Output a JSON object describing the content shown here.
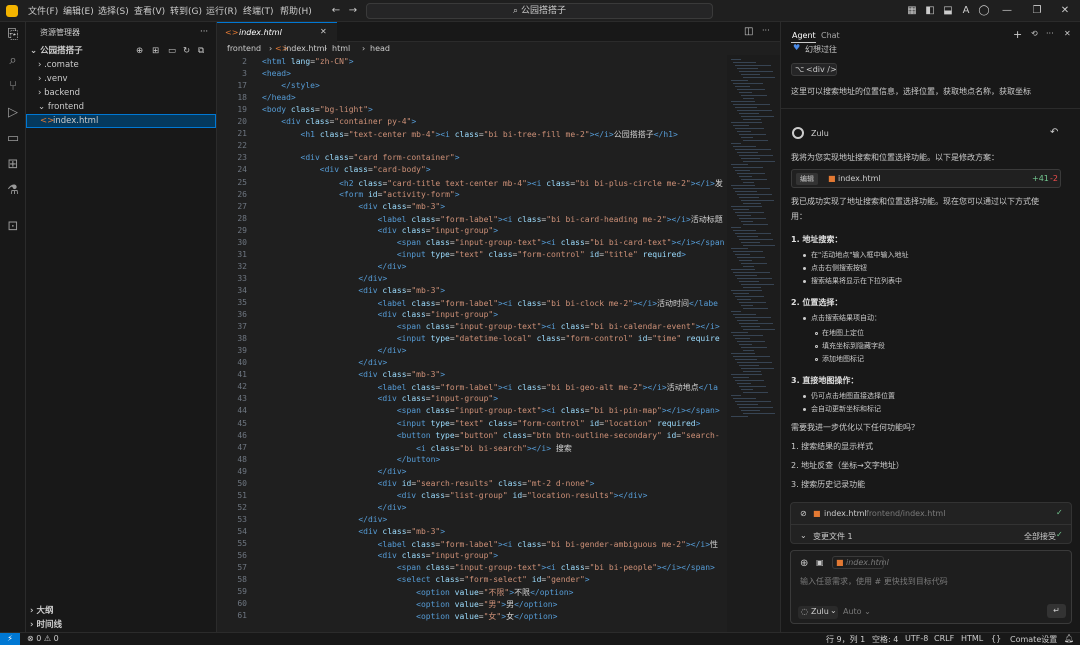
{
  "title_bar": {
    "menus": [
      "文件(F)",
      "编辑(E)",
      "选择(S)",
      "查看(V)",
      "转到(G)",
      "运行(R)",
      "终端(T)",
      "帮助(H)"
    ],
    "search": "公园搭搭子",
    "nav_back": "←",
    "nav_forward": "→"
  },
  "explorer": {
    "title": "资源管理器",
    "root": "公园搭搭子",
    "items": [
      {
        "label": "› .comate"
      },
      {
        "label": "› .venv"
      },
      {
        "label": "› backend"
      },
      {
        "label": "⌄ frontend"
      },
      {
        "label": "index.html"
      }
    ],
    "outline": "大纲",
    "timeline": "时间线"
  },
  "editor": {
    "tab": "index.html",
    "breadcrumbs": [
      "frontend",
      "index.html",
      "html",
      "head"
    ],
    "lines": [
      {
        "n": "2",
        "html": "<span class=tg>&lt;html</span> <span class=at>lang</span>=<span class=st>\"zh-CN\"</span><span class=tg>&gt;</span>"
      },
      {
        "n": "3",
        "html": "<span class=tg>&lt;head&gt;</span>"
      },
      {
        "n": "17",
        "html": "    <span class=tg>&lt;/style&gt;</span>"
      },
      {
        "n": "18",
        "html": "<span class=tg>&lt;/head&gt;</span>"
      },
      {
        "n": "19",
        "html": "<span class=tg>&lt;body</span> <span class=at>class</span>=<span class=st>\"bg-light\"</span><span class=tg>&gt;</span>"
      },
      {
        "n": "20",
        "html": "    <span class=tg>&lt;div</span> <span class=at>class</span>=<span class=st>\"container py-4\"</span><span class=tg>&gt;</span>"
      },
      {
        "n": "21",
        "html": "        <span class=tg>&lt;h1</span> <span class=at>class</span>=<span class=st>\"text-center mb-4\"</span><span class=tg>&gt;&lt;i</span> <span class=at>class</span>=<span class=st>\"bi bi-tree-fill me-2\"</span><span class=tg>&gt;&lt;/i&gt;</span><span class=tx>公园搭搭子</span><span class=tg>&lt;/h1&gt;</span>"
      },
      {
        "n": "22",
        "html": ""
      },
      {
        "n": "23",
        "html": "        <span class=tg>&lt;div</span> <span class=at>class</span>=<span class=st>\"card form-container\"</span><span class=tg>&gt;</span>"
      },
      {
        "n": "24",
        "html": "            <span class=tg>&lt;div</span> <span class=at>class</span>=<span class=st>\"card-body\"</span><span class=tg>&gt;</span>"
      },
      {
        "n": "25",
        "html": "                <span class=tg>&lt;h2</span> <span class=at>class</span>=<span class=st>\"card-title text-center mb-4\"</span><span class=tg>&gt;&lt;i</span> <span class=at>class</span>=<span class=st>\"bi bi-plus-circle me-2\"</span><span class=tg>&gt;&lt;/i&gt;</span><span class=tx>发</span>"
      },
      {
        "n": "26",
        "html": "                <span class=tg>&lt;form</span> <span class=at>id</span>=<span class=st>\"activity-form\"</span><span class=tg>&gt;</span>"
      },
      {
        "n": "27",
        "html": "                    <span class=tg>&lt;div</span> <span class=at>class</span>=<span class=st>\"mb-3\"</span><span class=tg>&gt;</span>"
      },
      {
        "n": "28",
        "html": "                        <span class=tg>&lt;label</span> <span class=at>class</span>=<span class=st>\"form-label\"</span><span class=tg>&gt;&lt;i</span> <span class=at>class</span>=<span class=st>\"bi bi-card-heading me-2\"</span><span class=tg>&gt;&lt;/i&gt;</span><span class=tx>活动标题</span>"
      },
      {
        "n": "29",
        "html": "                        <span class=tg>&lt;div</span> <span class=at>class</span>=<span class=st>\"input-group\"</span><span class=tg>&gt;</span>"
      },
      {
        "n": "30",
        "html": "                            <span class=tg>&lt;span</span> <span class=at>class</span>=<span class=st>\"input-group-text\"</span><span class=tg>&gt;&lt;i</span> <span class=at>class</span>=<span class=st>\"bi bi-card-text\"</span><span class=tg>&gt;&lt;/i&gt;&lt;/span</span>"
      },
      {
        "n": "31",
        "html": "                            <span class=tg>&lt;input</span> <span class=at>type</span>=<span class=st>\"text\"</span> <span class=at>class</span>=<span class=st>\"form-control\"</span> <span class=at>id</span>=<span class=st>\"title\"</span> <span class=at>required</span><span class=tg>&gt;</span>"
      },
      {
        "n": "32",
        "html": "                        <span class=tg>&lt;/div&gt;</span>"
      },
      {
        "n": "33",
        "html": "                    <span class=tg>&lt;/div&gt;</span>"
      },
      {
        "n": "34",
        "html": "                    <span class=tg>&lt;div</span> <span class=at>class</span>=<span class=st>\"mb-3\"</span><span class=tg>&gt;</span>"
      },
      {
        "n": "35",
        "html": "                        <span class=tg>&lt;label</span> <span class=at>class</span>=<span class=st>\"form-label\"</span><span class=tg>&gt;&lt;i</span> <span class=at>class</span>=<span class=st>\"bi bi-clock me-2\"</span><span class=tg>&gt;&lt;/i&gt;</span><span class=tx>活动时间</span><span class=tg>&lt;/labe</span>"
      },
      {
        "n": "36",
        "html": "                        <span class=tg>&lt;div</span> <span class=at>class</span>=<span class=st>\"input-group\"</span><span class=tg>&gt;</span>"
      },
      {
        "n": "37",
        "html": "                            <span class=tg>&lt;span</span> <span class=at>class</span>=<span class=st>\"input-group-text\"</span><span class=tg>&gt;&lt;i</span> <span class=at>class</span>=<span class=st>\"bi bi-calendar-event\"</span><span class=tg>&gt;&lt;/i&gt;</span>"
      },
      {
        "n": "38",
        "html": "                            <span class=tg>&lt;input</span> <span class=at>type</span>=<span class=st>\"datetime-local\"</span> <span class=at>class</span>=<span class=st>\"form-control\"</span> <span class=at>id</span>=<span class=st>\"time\"</span> <span class=at>require</span>"
      },
      {
        "n": "39",
        "html": "                        <span class=tg>&lt;/div&gt;</span>"
      },
      {
        "n": "40",
        "html": "                    <span class=tg>&lt;/div&gt;</span>"
      },
      {
        "n": "41",
        "html": "                    <span class=tg>&lt;div</span> <span class=at>class</span>=<span class=st>\"mb-3\"</span><span class=tg>&gt;</span>"
      },
      {
        "n": "42",
        "html": "                        <span class=tg>&lt;label</span> <span class=at>class</span>=<span class=st>\"form-label\"</span><span class=tg>&gt;&lt;i</span> <span class=at>class</span>=<span class=st>\"bi bi-geo-alt me-2\"</span><span class=tg>&gt;&lt;/i&gt;</span><span class=tx>活动地点</span><span class=tg>&lt;/la</span>"
      },
      {
        "n": "43",
        "html": "                        <span class=tg>&lt;div</span> <span class=at>class</span>=<span class=st>\"input-group\"</span><span class=tg>&gt;</span>"
      },
      {
        "n": "44",
        "html": "                            <span class=tg>&lt;span</span> <span class=at>class</span>=<span class=st>\"input-group-text\"</span><span class=tg>&gt;&lt;i</span> <span class=at>class</span>=<span class=st>\"bi bi-pin-map\"</span><span class=tg>&gt;&lt;/i&gt;&lt;/span&gt;</span>"
      },
      {
        "n": "45",
        "html": "                            <span class=tg>&lt;input</span> <span class=at>type</span>=<span class=st>\"text\"</span> <span class=at>class</span>=<span class=st>\"form-control\"</span> <span class=at>id</span>=<span class=st>\"location\"</span> <span class=at>required</span><span class=tg>&gt;</span>"
      },
      {
        "n": "46",
        "html": "                            <span class=tg>&lt;button</span> <span class=at>type</span>=<span class=st>\"button\"</span> <span class=at>class</span>=<span class=st>\"btn btn-outline-secondary\"</span> <span class=at>id</span>=<span class=st>\"search-</span>"
      },
      {
        "n": "47",
        "html": "                                <span class=tg>&lt;i</span> <span class=at>class</span>=<span class=st>\"bi bi-search\"</span><span class=tg>&gt;&lt;/i&gt;</span><span class=tx> 搜索</span>"
      },
      {
        "n": "48",
        "html": "                            <span class=tg>&lt;/button&gt;</span>"
      },
      {
        "n": "49",
        "html": "                        <span class=tg>&lt;/div&gt;</span>"
      },
      {
        "n": "50",
        "html": "                        <span class=tg>&lt;div</span> <span class=at>id</span>=<span class=st>\"search-results\"</span> <span class=at>class</span>=<span class=st>\"mt-2 d-none\"</span><span class=tg>&gt;</span>"
      },
      {
        "n": "51",
        "html": "                            <span class=tg>&lt;div</span> <span class=at>class</span>=<span class=st>\"list-group\"</span> <span class=at>id</span>=<span class=st>\"location-results\"</span><span class=tg>&gt;&lt;/div&gt;</span>"
      },
      {
        "n": "52",
        "html": "                        <span class=tg>&lt;/div&gt;</span>"
      },
      {
        "n": "53",
        "html": "                    <span class=tg>&lt;/div&gt;</span>"
      },
      {
        "n": "54",
        "html": "                    <span class=tg>&lt;div</span> <span class=at>class</span>=<span class=st>\"mb-3\"</span><span class=tg>&gt;</span>"
      },
      {
        "n": "55",
        "html": "                        <span class=tg>&lt;label</span> <span class=at>class</span>=<span class=st>\"form-label\"</span><span class=tg>&gt;&lt;i</span> <span class=at>class</span>=<span class=st>\"bi bi-gender-ambiguous me-2\"</span><span class=tg>&gt;&lt;/i&gt;</span><span class=tx>性</span>"
      },
      {
        "n": "56",
        "html": "                        <span class=tg>&lt;div</span> <span class=at>class</span>=<span class=st>\"input-group\"</span><span class=tg>&gt;</span>"
      },
      {
        "n": "57",
        "html": "                            <span class=tg>&lt;span</span> <span class=at>class</span>=<span class=st>\"input-group-text\"</span><span class=tg>&gt;&lt;i</span> <span class=at>class</span>=<span class=st>\"bi bi-people\"</span><span class=tg>&gt;&lt;/i&gt;&lt;/span&gt;</span>"
      },
      {
        "n": "58",
        "html": "                            <span class=tg>&lt;select</span> <span class=at>class</span>=<span class=st>\"form-select\"</span> <span class=at>id</span>=<span class=st>\"gender\"</span><span class=tg>&gt;</span>"
      },
      {
        "n": "59",
        "html": "                                <span class=tg>&lt;option</span> <span class=at>value</span>=<span class=st>\"不限\"</span><span class=tg>&gt;</span><span class=tx>不限</span><span class=tg>&lt;/option&gt;</span>"
      },
      {
        "n": "60",
        "html": "                                <span class=tg>&lt;option</span> <span class=at>value</span>=<span class=st>\"男\"</span><span class=tg>&gt;</span><span class=tx>男</span><span class=tg>&lt;/option&gt;</span>"
      },
      {
        "n": "61",
        "html": "                                <span class=tg>&lt;option</span> <span class=at>value</span>=<span class=st>\"女\"</span><span class=tg>&gt;</span><span class=tx>女</span><span class=tg>&lt;/option&gt;</span>"
      }
    ]
  },
  "agent": {
    "tab_agent": "Agent",
    "tab_chat": "Chat",
    "prev_title": "幻想过往",
    "context_chip": "<div />",
    "user_msg": "这里可以搜索地址的位置信息，选择位置，获取地点名称，获取坐标",
    "bot_name": "Zulu",
    "intro": "我将为您实现地址搜索和位置选择功能。以下是修改方案：",
    "edit_tag": "编辑",
    "edit_file": "index.html",
    "edit_add": "+41",
    "edit_del": "-2",
    "done1": "我已成功实现了地址搜索和位置选择功能。现在您可以通过以下方式使",
    "done2": "用：",
    "s1_title": "1. 地址搜索：",
    "s1_items": [
      "在\"活动地点\"输入框中输入地址",
      "点击右侧搜索按钮",
      "搜索结果将显示在下拉列表中"
    ],
    "s2_title": "2. 位置选择：",
    "s2_lead": "点击搜索结果项自动：",
    "s2_items": [
      "在地图上定位",
      "填充坐标到隐藏字段",
      "添加地图标记"
    ],
    "s3_title": "3. 直接地图操作：",
    "s3_items": [
      "仍可点击地图直接选择位置",
      "会自动更新坐标和标记"
    ],
    "question": "需要我进一步优化以下任何功能吗？",
    "opts": [
      "1. 搜索结果的显示样式",
      "2. 地址反查（坐标→文字地址）",
      "3. 搜索历史记录功能"
    ],
    "change_file": "index.html",
    "change_path": "frontend/index.html",
    "changes_label": "变更文件 1",
    "accept_all": "全部接受",
    "input_chip": "index.html",
    "input_placeholder": "输入任意需求，使用 # 更快找到目标代码",
    "model": "Zulu",
    "mode": "Auto"
  },
  "status": {
    "errors": "⊗ 0  ⚠ 0",
    "position": "行 9，列 1",
    "spaces": "空格: 4",
    "encoding": "UTF-8",
    "eol": "CRLF",
    "lang": "HTML",
    "comate": "Comate设置"
  }
}
